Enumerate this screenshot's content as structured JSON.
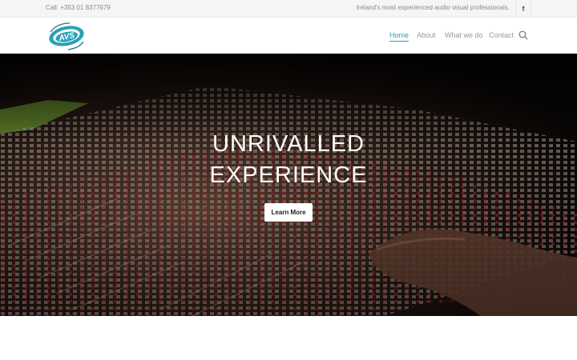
{
  "topbar": {
    "call": "Call: +353 01 8377679",
    "tagline": "Ireland's most experienced audio visual professionals.",
    "facebook_glyph": "f"
  },
  "logo": {
    "letters": "AVS",
    "ring_text_top": "AUDIO VISUAL",
    "ring_text_bottom": "SERVICES",
    "colors": {
      "primary": "#2aa1b6",
      "dark": "#1b6f86"
    }
  },
  "nav": {
    "items": [
      {
        "label": "Home",
        "active": true
      },
      {
        "label": "About",
        "active": false
      },
      {
        "label": "What we do",
        "active": false
      },
      {
        "label": "Contact",
        "active": false
      }
    ],
    "search_icon": "search-icon"
  },
  "hero": {
    "title_line1": "UNRIVALLED",
    "title_line2": "EXPERIENCE",
    "button_label": "Learn More"
  },
  "colors": {
    "accent": "#2aa1b6",
    "topbar_bg": "#f5f5f5",
    "hero_text": "#ffffff"
  }
}
